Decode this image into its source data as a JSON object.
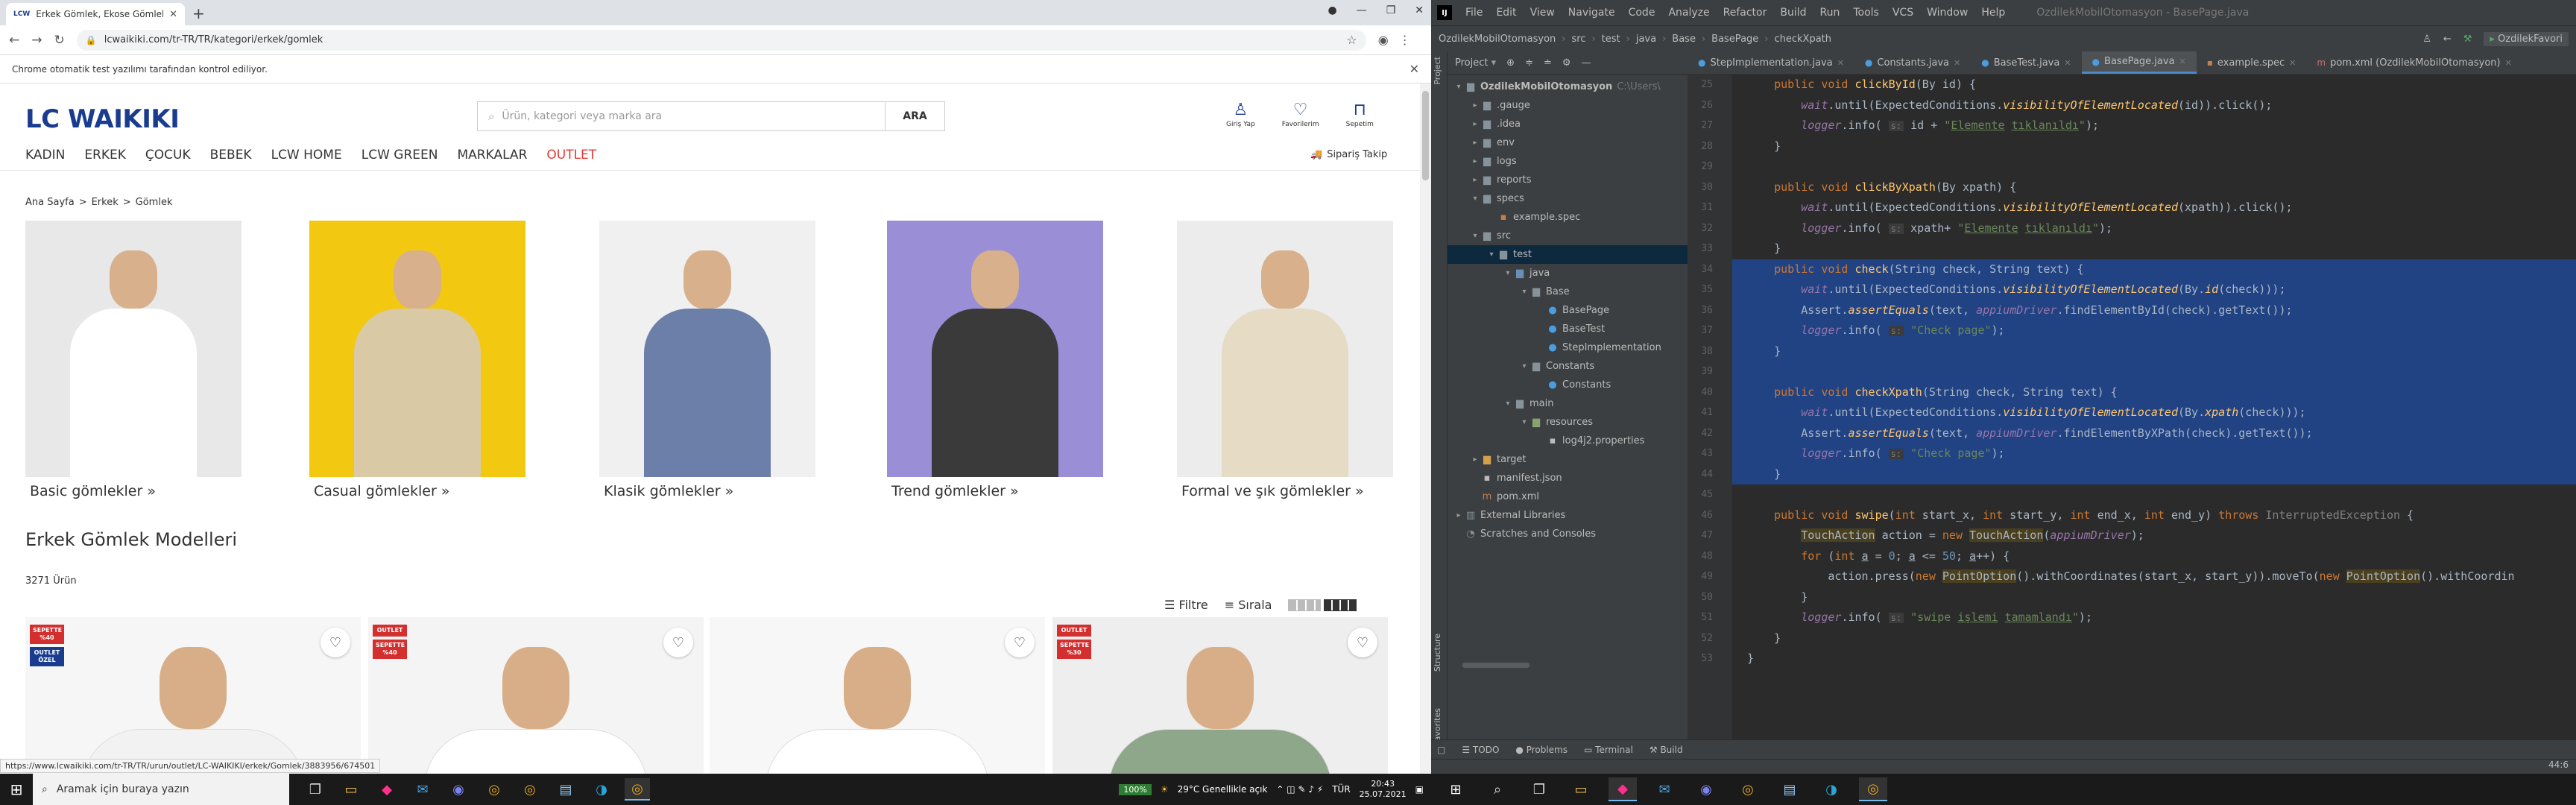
{
  "browser": {
    "tab_title": "Erkek Gömlek, Ekose Gömlek, Slim Fit",
    "tab_favicon": "LCW",
    "url": "lcwaikiki.com/tr-TR/TR/kategori/erkek/gomlek",
    "infobar_text": "Chrome otomatik test yazılımı tarafından kontrol ediliyor.",
    "status_url": "https://www.lcwaikiki.com/tr-TR/TR/urun/outlet/LC-WAIKIKI/erkek/Gomlek/3883956/674501"
  },
  "site": {
    "logo": "LC WAIKIKI",
    "search_placeholder": "Ürün, kategori veya marka ara",
    "search_button": "ARA",
    "user_icons": [
      {
        "icon": "user-icon",
        "label": "Giriş Yap"
      },
      {
        "icon": "heart-icon",
        "label": "Favorilerim"
      },
      {
        "icon": "bag-icon",
        "label": "Sepetim"
      }
    ],
    "nav": [
      "KADIN",
      "ERKEK",
      "ÇOCUK",
      "BEBEK",
      "LCW HOME",
      "LCW GREEN",
      "MARKALAR",
      "OUTLET"
    ],
    "delivery": "Sipariş Takip",
    "breadcrumb": [
      "Ana Sayfa",
      ">",
      "Erkek",
      ">",
      "Gömlek"
    ],
    "categories": [
      {
        "label": "Basic gömlekler »",
        "bg": "#e8e8e8",
        "shirt": "#ffffff"
      },
      {
        "label": "Casual gömlekler »",
        "bg": "#f2c811",
        "shirt": "#d9c9a4"
      },
      {
        "label": "Klasik gömlekler »",
        "bg": "#f0f0f0",
        "shirt": "#6b7fa8"
      },
      {
        "label": "Trend gömlekler »",
        "bg": "#9a8fd6",
        "shirt": "#3a3a3a"
      },
      {
        "label": "Formal ve şık gömlekler »",
        "bg": "#ececec",
        "shirt": "#e6dcc6"
      }
    ],
    "section_title": "Erkek Gömlek Modelleri",
    "product_count": "3271 Ürün",
    "filter": "Filtre",
    "sort": "Sırala",
    "products": [
      {
        "badges": [
          {
            "text": "SEPETTE %40",
            "type": "red"
          },
          {
            "text": "OUTLET ÖZEL",
            "type": "blue"
          }
        ],
        "shirt": "#f2f2f2",
        "bg": "#f6f6f6"
      },
      {
        "badges": [
          {
            "text": "OUTLET",
            "type": "red"
          },
          {
            "text": "SEPETTE %40",
            "type": "red"
          }
        ],
        "shirt": "#ffffff",
        "bg": "#f4f4f4"
      },
      {
        "badges": [],
        "shirt": "#ffffff",
        "bg": "#f7f7f7"
      },
      {
        "badges": [
          {
            "text": "OUTLET",
            "type": "red"
          },
          {
            "text": "SEPETTE %30",
            "type": "red"
          }
        ],
        "shirt": "#8ea68a",
        "bg": "#eeeeee"
      }
    ]
  },
  "taskbar_left": {
    "search_placeholder": "Aramak için buraya yazın",
    "battery": "100%",
    "weather": "29°C  Genellikle açık",
    "lang": "TÜR",
    "time": "20:43",
    "date": "25.07.2021"
  },
  "ide": {
    "menu": [
      "File",
      "Edit",
      "View",
      "Navigate",
      "Code",
      "Analyze",
      "Refactor",
      "Build",
      "Run",
      "Tools",
      "VCS",
      "Window",
      "Help"
    ],
    "title": "OzdilekMobilOtomasyon - BasePage.java",
    "breadcrumb": [
      "OzdilekMobilOtomasyon",
      "src",
      "test",
      "java",
      "Base",
      "BasePage",
      "checkXpath"
    ],
    "run_config": "OzdilekFavori",
    "project_label": "Project",
    "tree": [
      {
        "label": "OzdilekMobilOtomasyon",
        "suffix": "C:\\Users\\",
        "indent": 0,
        "arrow": "▾",
        "type": "fold",
        "bold": true
      },
      {
        "label": ".gauge",
        "indent": 1,
        "arrow": "▸",
        "type": "fold"
      },
      {
        "label": ".idea",
        "indent": 1,
        "arrow": "▸",
        "type": "fold"
      },
      {
        "label": "env",
        "indent": 1,
        "arrow": "▸",
        "type": "fold"
      },
      {
        "label": "logs",
        "indent": 1,
        "arrow": "▸",
        "type": "fold"
      },
      {
        "label": "reports",
        "indent": 1,
        "arrow": "▸",
        "type": "fold"
      },
      {
        "label": "specs",
        "indent": 1,
        "arrow": "▾",
        "type": "fold"
      },
      {
        "label": "example.spec",
        "indent": 2,
        "arrow": "",
        "type": "spec"
      },
      {
        "label": "src",
        "indent": 1,
        "arrow": "▾",
        "type": "fold"
      },
      {
        "label": "test",
        "indent": 2,
        "arrow": "▾",
        "type": "fold",
        "selected": true
      },
      {
        "label": "java",
        "indent": 3,
        "arrow": "▾",
        "type": "src"
      },
      {
        "label": "Base",
        "indent": 4,
        "arrow": "▾",
        "type": "fold"
      },
      {
        "label": "BasePage",
        "indent": 5,
        "arrow": "",
        "type": "java"
      },
      {
        "label": "BaseTest",
        "indent": 5,
        "arrow": "",
        "type": "java"
      },
      {
        "label": "StepImplementation",
        "indent": 5,
        "arrow": "",
        "type": "java"
      },
      {
        "label": "Constants",
        "indent": 4,
        "arrow": "▾",
        "type": "fold"
      },
      {
        "label": "Constants",
        "indent": 5,
        "arrow": "",
        "type": "java"
      },
      {
        "label": "main",
        "indent": 3,
        "arrow": "▾",
        "type": "fold"
      },
      {
        "label": "resources",
        "indent": 4,
        "arrow": "▾",
        "type": "res"
      },
      {
        "label": "log4j2.properties",
        "indent": 5,
        "arrow": "",
        "type": "file"
      },
      {
        "label": "target",
        "indent": 1,
        "arrow": "▸",
        "type": "tgt"
      },
      {
        "label": "manifest.json",
        "indent": 1,
        "arrow": "",
        "type": "file"
      },
      {
        "label": "pom.xml",
        "indent": 1,
        "arrow": "",
        "type": "maven"
      },
      {
        "label": "External Libraries",
        "indent": 0,
        "arrow": "▸",
        "type": "lib"
      },
      {
        "label": "Scratches and Consoles",
        "indent": 0,
        "arrow": "",
        "type": "scratch"
      }
    ],
    "tabs": [
      {
        "label": "StepImplementation.java",
        "type": "java"
      },
      {
        "label": "Constants.java",
        "type": "java"
      },
      {
        "label": "BaseTest.java",
        "type": "java"
      },
      {
        "label": "BasePage.java",
        "type": "java",
        "active": true
      },
      {
        "label": "example.spec",
        "type": "spec"
      },
      {
        "label": "pom.xml (OzdilekMobilOtomasyon)",
        "type": "maven"
      }
    ],
    "line_numbers": [
      "25",
      "26",
      "27",
      "28",
      "29",
      "30",
      "31",
      "32",
      "33",
      "34",
      "35",
      "36",
      "37",
      "38",
      "39",
      "40",
      "41",
      "42",
      "43",
      "44",
      "45",
      "46",
      "47",
      "48",
      "49",
      "50",
      "51",
      "52",
      "53"
    ],
    "bottom_tools": [
      "TODO",
      "Problems",
      "Terminal",
      "Build"
    ],
    "left_strip": [
      "Project",
      "Structure",
      "Favorites"
    ],
    "status_pos": "44:6"
  }
}
